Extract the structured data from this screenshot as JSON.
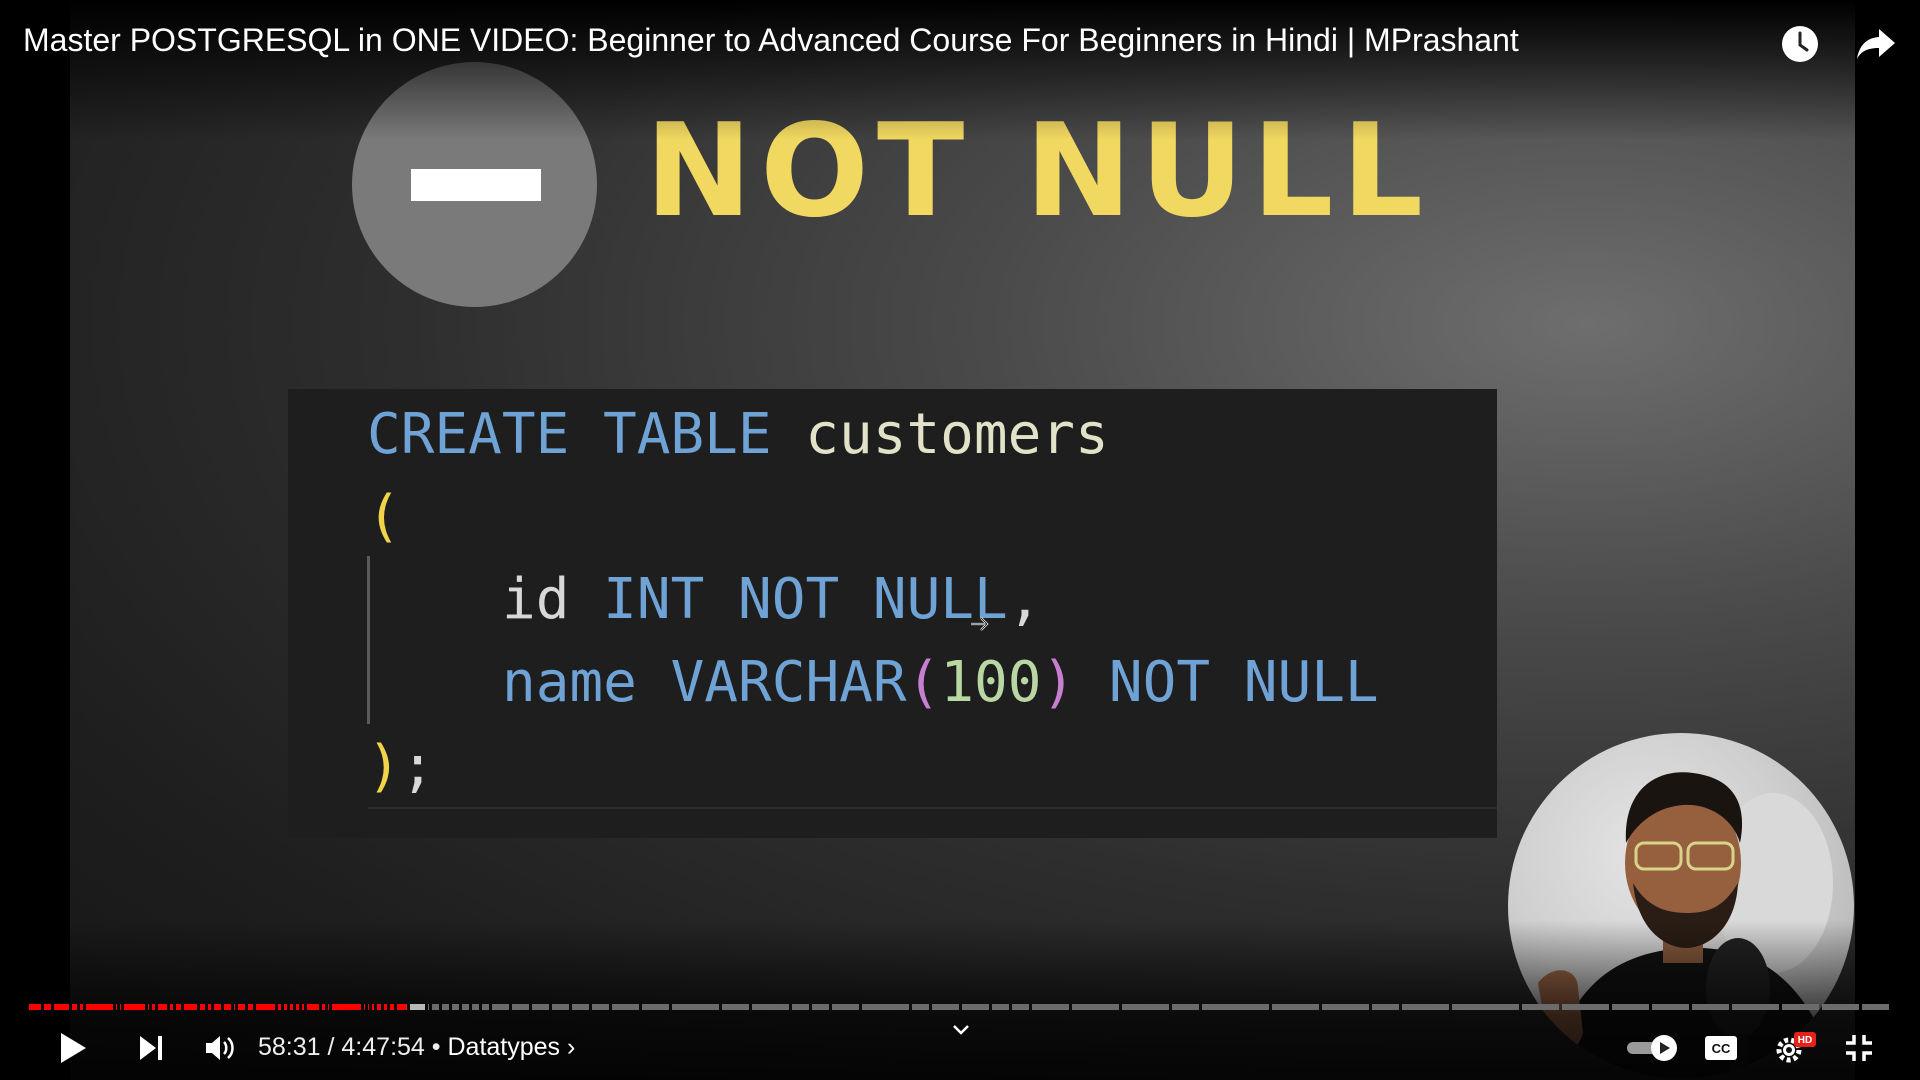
{
  "video": {
    "title": "Master POSTGRESQL in ONE VIDEO: Beginner to Advanced Course For Beginners in Hindi | MPrashant"
  },
  "slide": {
    "headline": "NOT NULL",
    "code": {
      "line1_kw": "CREATE TABLE",
      "line1_ident": "customers",
      "open_paren": "(",
      "line3_ident": "id",
      "line3_kw": "INT NOT NULL",
      "line3_comma": ",",
      "line4_ident": "name",
      "line4_kw": "VARCHAR",
      "line4_popen": "(",
      "line4_num": "100",
      "line4_pclose": ")",
      "line4_kw2": "NOT NULL",
      "close_paren": ")",
      "semicolon": ";"
    }
  },
  "top_icons": [
    "watch-later-icon",
    "share-icon"
  ],
  "controls": {
    "current_time": "58:31",
    "separator": " / ",
    "duration": "4:47:54",
    "bullet": " • ",
    "chapter": "Datatypes",
    "chapter_chevron": "›",
    "progress_fraction": 0.203,
    "buffered_fraction": 0.205,
    "icons": [
      "play-icon",
      "next-icon",
      "volume-icon",
      "chevron-down-icon",
      "autoplay-toggle-icon",
      "captions-icon",
      "settings-icon",
      "exit-fullscreen-icon"
    ],
    "hd_badge": "HD",
    "cc_label": "CC"
  },
  "colors": {
    "played": "#ff0000",
    "unplayed": "#6b6b6b",
    "headline": "#f1d860",
    "code_bg": "#1e1e1e"
  }
}
